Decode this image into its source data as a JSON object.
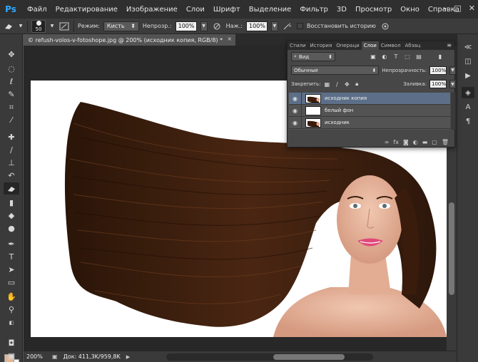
{
  "app": {
    "logo": "Ps"
  },
  "menu": [
    "Файл",
    "Редактирование",
    "Изображение",
    "Слои",
    "Шрифт",
    "Выделение",
    "Фильтр",
    "3D",
    "Просмотр",
    "Окно",
    "Справка"
  ],
  "window_controls": [
    "–",
    "□",
    "✕"
  ],
  "options": {
    "brush_size": "50",
    "mode_label": "Режим:",
    "mode_value": "Кисть",
    "opacity_label": "Непрозр.:",
    "opacity_value": "100%",
    "flow_label": "Наж.:",
    "flow_value": "100%",
    "restore_history_label": "Восстановить историю"
  },
  "document": {
    "tab_title": "© refush-volos-v-fotoshope.jpg @ 200% (исходник копия, RGB/8) *",
    "close": "×",
    "zoom": "200%",
    "doc_info": "Док: 411,3K/959,8K"
  },
  "layers_panel": {
    "tabs": [
      "Стили",
      "История",
      "Операци",
      "Слои",
      "Символ",
      "Абзац"
    ],
    "active_tab_index": 3,
    "menu_icon": "≡",
    "filter_kind": "Вид",
    "blend_mode": "Обычные",
    "opacity_label": "Непрозрачность:",
    "opacity_value": "100%",
    "lock_label": "Закрепить:",
    "fill_label": "Заливка:",
    "fill_value": "100%",
    "layers": [
      {
        "name": "исходник копия",
        "visible": true,
        "selected": true,
        "thumb": "hair"
      },
      {
        "name": "белый фон",
        "visible": true,
        "selected": false,
        "thumb": "white"
      },
      {
        "name": "исходник",
        "visible": true,
        "selected": false,
        "thumb": "hair"
      }
    ],
    "footer_icons": [
      "link-icon",
      "fx-icon",
      "mask-icon",
      "adjustment-icon",
      "group-icon",
      "new-layer-icon",
      "trash-icon"
    ]
  },
  "colors": {
    "foreground": "#e0b697",
    "background": "#ffffff",
    "selected_layer": "#5d6f88"
  }
}
